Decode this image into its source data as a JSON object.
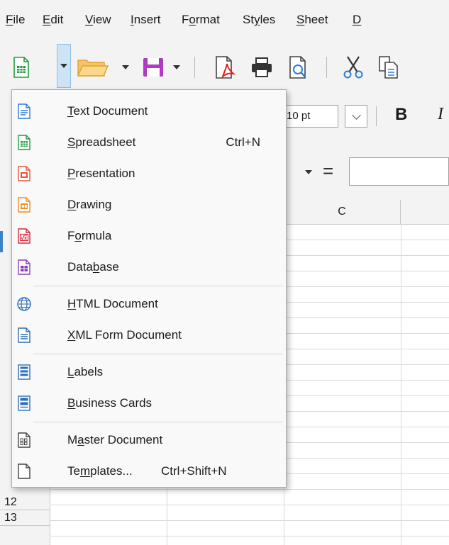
{
  "menubar": {
    "items": [
      {
        "pre": "",
        "u": "F",
        "post": "ile"
      },
      {
        "pre": "",
        "u": "E",
        "post": "dit"
      },
      {
        "pre": "",
        "u": "V",
        "post": "iew"
      },
      {
        "pre": "",
        "u": "I",
        "post": "nsert"
      },
      {
        "pre": "F",
        "u": "o",
        "post": "rmat"
      },
      {
        "pre": "St",
        "u": "y",
        "post": "les"
      },
      {
        "pre": "",
        "u": "S",
        "post": "heet"
      },
      {
        "pre": "",
        "u": "D",
        "post": ""
      }
    ]
  },
  "toolbar": {
    "font_size": "10 pt",
    "bold": "B",
    "italic": "I"
  },
  "formula_bar": {
    "equals": "="
  },
  "grid": {
    "column_c": "C",
    "rows": [
      "12",
      "13"
    ]
  },
  "new_menu": {
    "items": [
      {
        "pre": "",
        "u": "T",
        "post": "ext Document",
        "shortcut": "",
        "icon": "text-document-icon",
        "color": "#2b7bd6"
      },
      {
        "pre": "",
        "u": "S",
        "post": "preadsheet",
        "shortcut": "Ctrl+N",
        "icon": "spreadsheet-icon",
        "color": "#1e9e3b"
      },
      {
        "pre": "",
        "u": "P",
        "post": "resentation",
        "shortcut": "",
        "icon": "presentation-icon",
        "color": "#e8553a"
      },
      {
        "pre": "",
        "u": "D",
        "post": "rawing",
        "shortcut": "",
        "icon": "drawing-icon",
        "color": "#f28c1e"
      },
      {
        "pre": "F",
        "u": "o",
        "post": "rmula",
        "shortcut": "",
        "icon": "formula-icon",
        "color": "#d9263b"
      },
      {
        "pre": "Data",
        "u": "b",
        "post": "ase",
        "shortcut": "",
        "icon": "database-icon",
        "color": "#8a3fb8"
      },
      {
        "pre": "",
        "u": "H",
        "post": "TML Document",
        "shortcut": "",
        "icon": "html-document-icon",
        "color": "#2b6fb5"
      },
      {
        "pre": "",
        "u": "X",
        "post": "ML Form Document",
        "shortcut": "",
        "icon": "xml-form-document-icon",
        "color": "#2b6fb5"
      },
      {
        "pre": "",
        "u": "L",
        "post": "abels",
        "shortcut": "",
        "icon": "labels-icon",
        "color": "#2b6fb5"
      },
      {
        "pre": "",
        "u": "B",
        "post": "usiness Cards",
        "shortcut": "",
        "icon": "business-cards-icon",
        "color": "#2b6fb5"
      },
      {
        "pre": "M",
        "u": "a",
        "post": "ster Document",
        "shortcut": "",
        "icon": "master-document-icon",
        "color": "#444444"
      },
      {
        "pre": "Te",
        "u": "m",
        "post": "plates...",
        "shortcut": "Ctrl+Shift+N",
        "icon": "templates-icon",
        "color": "#444444"
      }
    ]
  }
}
